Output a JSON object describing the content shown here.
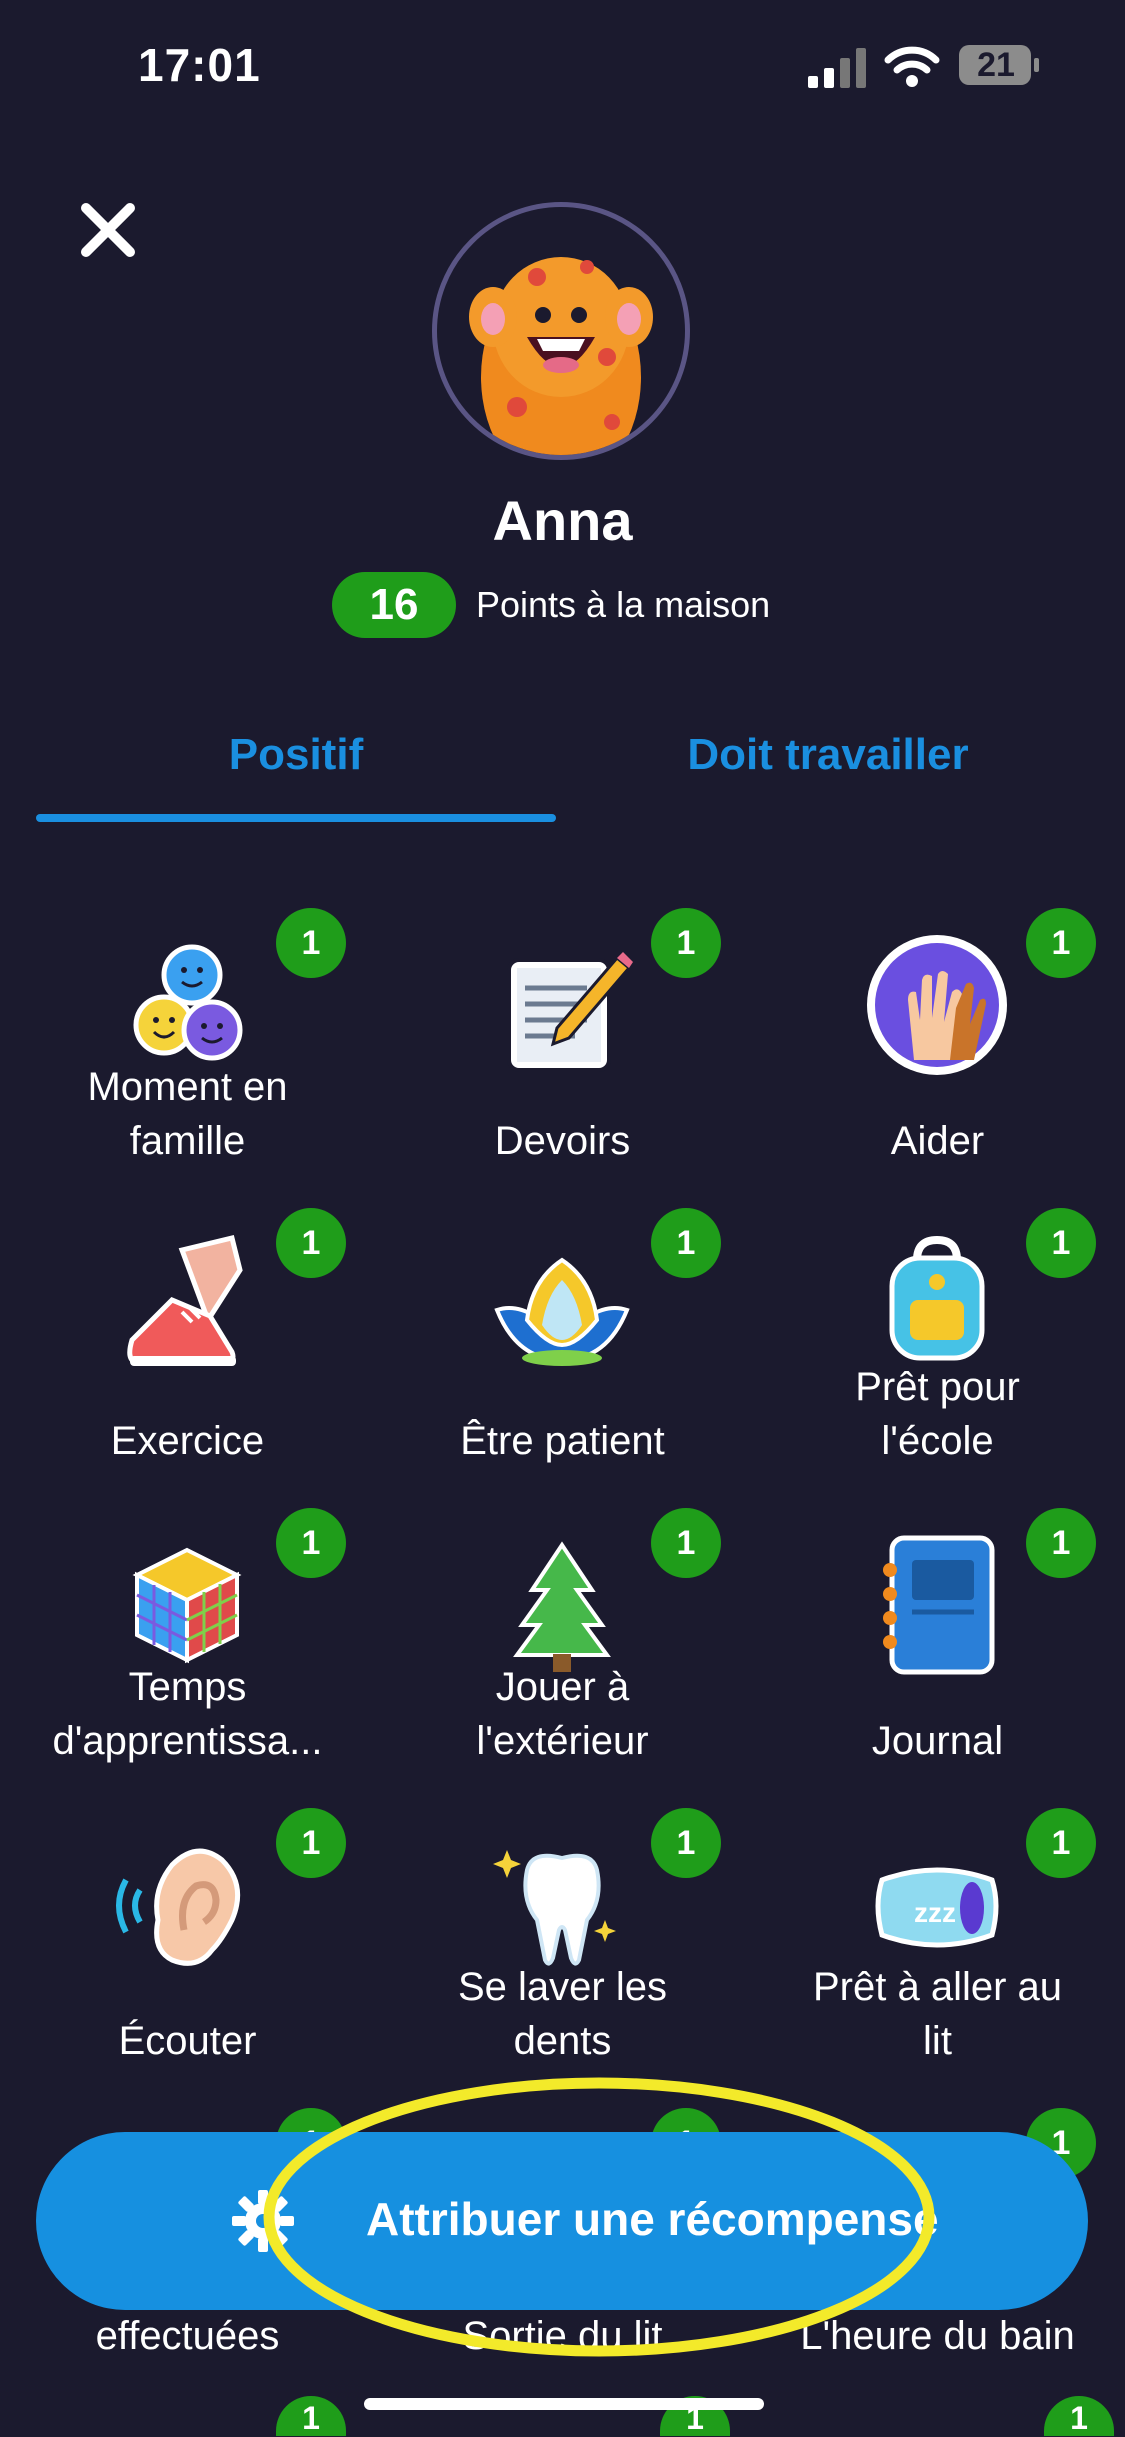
{
  "status": {
    "time": "17:01",
    "battery": "21"
  },
  "profile": {
    "name": "Anna",
    "points": "16",
    "points_label": "Points à la maison"
  },
  "tabs": [
    {
      "label": "Positif",
      "active": true
    },
    {
      "label": "Doit travailler",
      "active": false
    }
  ],
  "skills": [
    {
      "label_line1": "Moment en",
      "label_line2": "famille",
      "count": "1",
      "icon": "family-faces-icon"
    },
    {
      "label_line1": "",
      "label_line2": "Devoirs",
      "count": "1",
      "icon": "homework-notepad-icon"
    },
    {
      "label_line1": "",
      "label_line2": "Aider",
      "count": "1",
      "icon": "helping-hands-icon"
    },
    {
      "label_line1": "",
      "label_line2": "Exercice",
      "count": "1",
      "icon": "sneaker-icon"
    },
    {
      "label_line1": "",
      "label_line2": "Être patient",
      "count": "1",
      "icon": "lotus-icon"
    },
    {
      "label_line1": "Prêt pour",
      "label_line2": "l'école",
      "count": "1",
      "icon": "backpack-icon"
    },
    {
      "label_line1": "Temps",
      "label_line2": "d'apprentissa...",
      "count": "1",
      "icon": "rubiks-cube-icon"
    },
    {
      "label_line1": "Jouer à",
      "label_line2": "l'extérieur",
      "count": "1",
      "icon": "pine-tree-icon"
    },
    {
      "label_line1": "",
      "label_line2": "Journal",
      "count": "1",
      "icon": "journal-icon"
    },
    {
      "label_line1": "",
      "label_line2": "Écouter",
      "count": "1",
      "icon": "ear-icon"
    },
    {
      "label_line1": "Se laver les",
      "label_line2": "dents",
      "count": "1",
      "icon": "tooth-icon"
    },
    {
      "label_line1": "Prêt à aller au",
      "label_line2": "lit",
      "count": "1",
      "icon": "pillow-icon"
    }
  ],
  "partial_row": [
    {
      "label": "effectuées",
      "count": "1"
    },
    {
      "label": "Sortie du lit",
      "count": "1"
    },
    {
      "label": "L'heure du bain",
      "count": "1"
    }
  ],
  "peek_row_counts": [
    "1",
    "1",
    "1"
  ],
  "reward_button": {
    "label": "Attribuer une récompense"
  },
  "colors": {
    "background": "#1b1a2e",
    "accent": "#1a8fe0",
    "badge_green": "#1f9d1a",
    "highlight": "#f3ea2a"
  }
}
